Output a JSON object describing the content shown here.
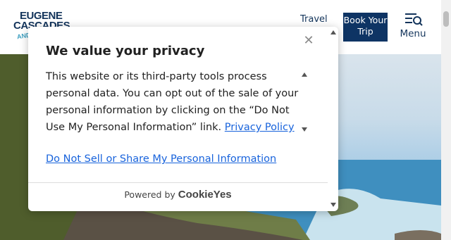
{
  "header": {
    "logo_line1": "EUGENE",
    "logo_line2": "CASCADES",
    "logo_line3": "AND",
    "travel_label": "Travel",
    "book_label": "Book Your Trip",
    "menu_label": "Menu"
  },
  "consent": {
    "title": "We value your privacy",
    "body_text": "This website or its third-party tools process personal data. You can opt out of the sale of your personal information by clicking on the “Do Not Use My Personal Information” link. ",
    "privacy_link": "Privacy Policy",
    "do_not_sell_link": "Do Not Sell or Share My Personal Information",
    "powered_by": "Powered by",
    "brand": "CookieYes",
    "close_icon": "close-icon"
  },
  "colors": {
    "navy": "#0e3464",
    "link_blue": "#1863dc",
    "text": "#212121"
  }
}
